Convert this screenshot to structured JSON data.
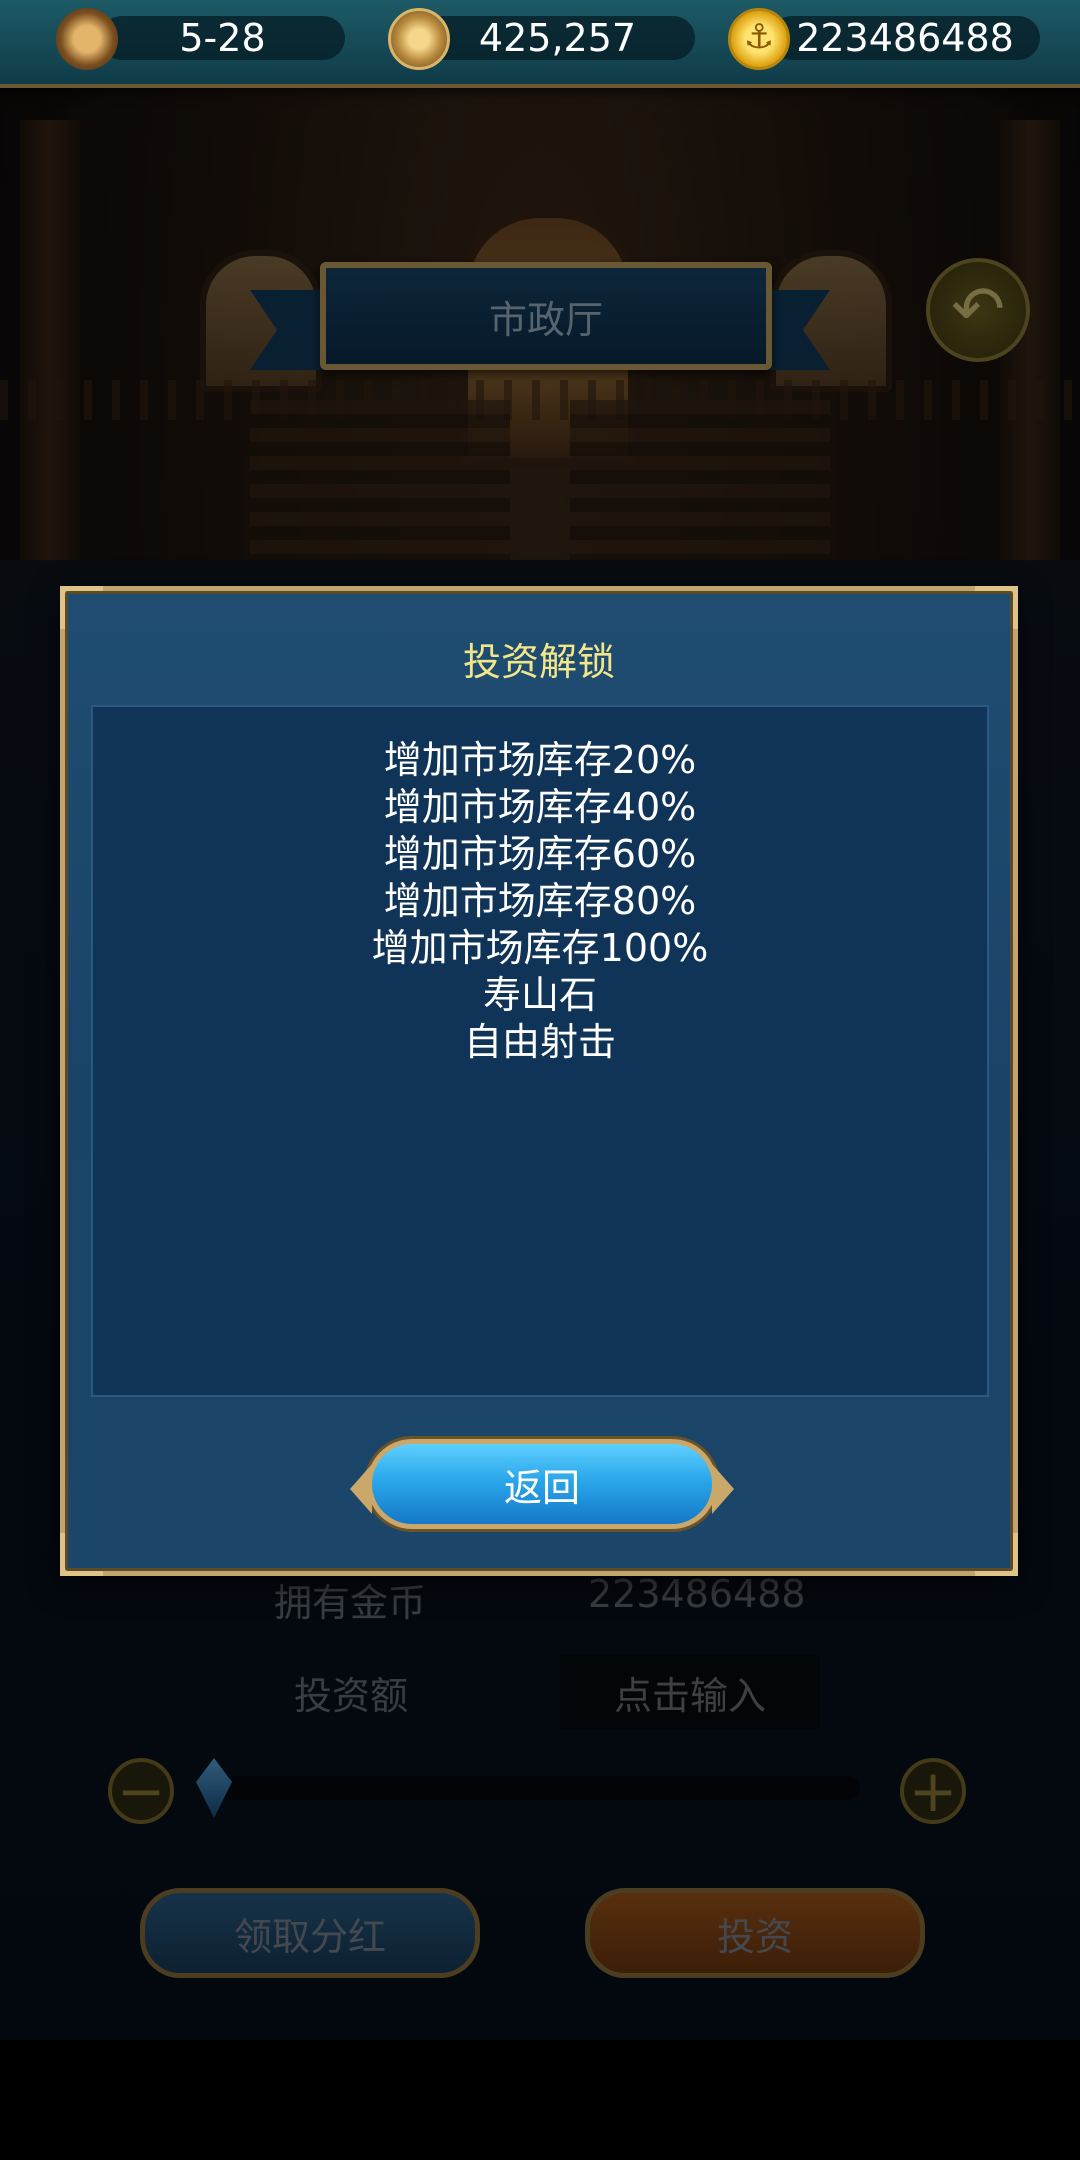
{
  "hud": {
    "turn_label": "5-28",
    "reputation_value": "425,257",
    "gold_value": "223486488",
    "turn_icon": "hourglass-icon",
    "reputation_icon": "compass-icon",
    "gold_icon": "gold-coin-icon"
  },
  "location": {
    "title": "市政厅",
    "back_icon": "return-arrow-icon"
  },
  "background_panel": {
    "owned_gold_label": "拥有金币",
    "owned_gold_value": "223486488",
    "invest_amount_label": "投资额",
    "invest_amount_placeholder": "点击输入",
    "minus_label": "−",
    "plus_label": "+",
    "claim_dividend_label": "领取分红",
    "invest_label": "投资",
    "slider_fraction": 0
  },
  "modal": {
    "title": "投资解锁",
    "unlock_items": [
      "增加市场库存20%",
      "增加市场库存40%",
      "增加市场库存60%",
      "增加市场库存80%",
      "增加市场库存100%",
      "寿山石",
      "自由射击"
    ],
    "return_label": "返回"
  },
  "colors": {
    "modal_title": "#f2e58a",
    "modal_border": "#c2a56a",
    "return_button": "#2aa7ea"
  }
}
